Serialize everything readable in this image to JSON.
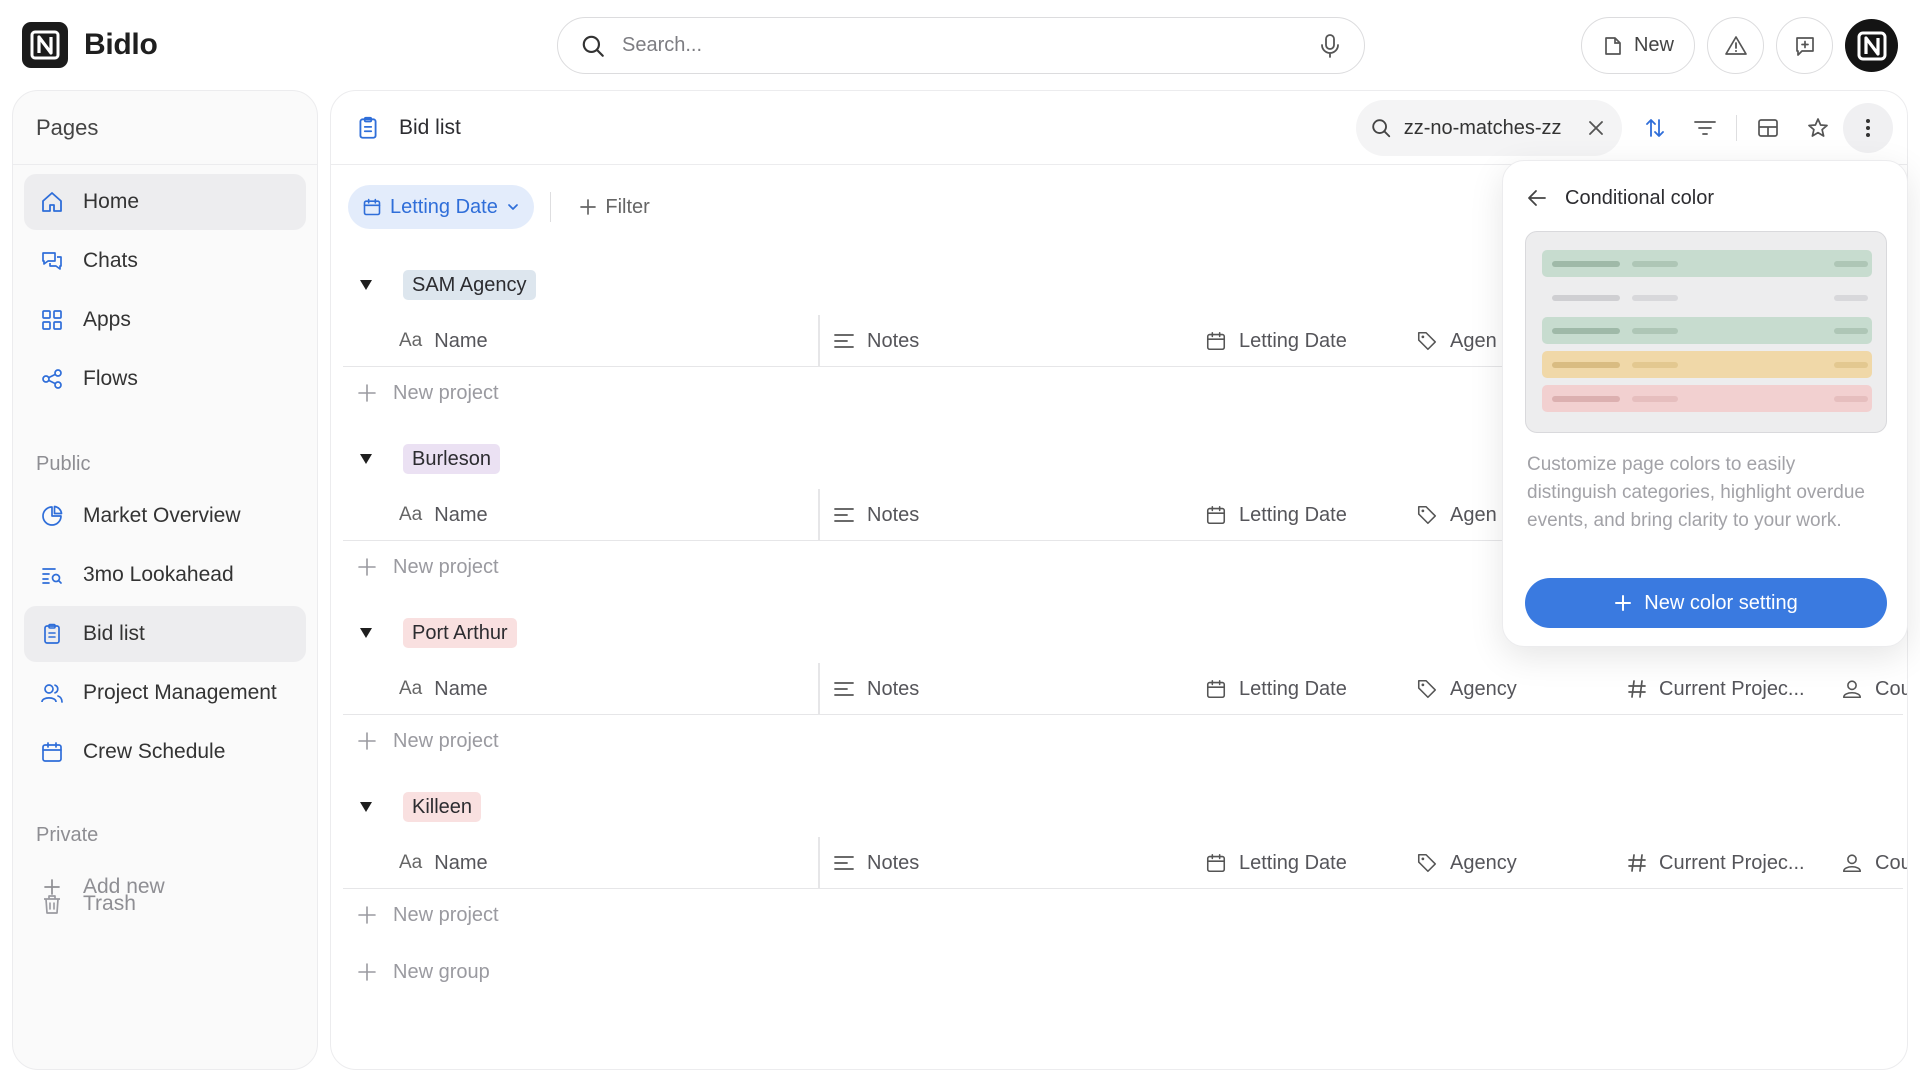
{
  "app": {
    "name": "Bidlo"
  },
  "search": {
    "placeholder": "Search..."
  },
  "top_actions": {
    "new_label": "New"
  },
  "sidebar": {
    "header": "Pages",
    "main_items": [
      {
        "label": "Home",
        "icon": "home-icon",
        "active": false
      },
      {
        "label": "Chats",
        "icon": "chats-icon",
        "active": false
      },
      {
        "label": "Apps",
        "icon": "apps-icon",
        "active": false
      },
      {
        "label": "Flows",
        "icon": "flows-icon",
        "active": false
      }
    ],
    "public_label": "Public",
    "public_items": [
      {
        "label": "Market Overview",
        "icon": "pie-chart-icon"
      },
      {
        "label": "3mo Lookahead",
        "icon": "list-search-icon"
      },
      {
        "label": "Bid list",
        "icon": "clipboard-icon",
        "active": true
      },
      {
        "label": "Project Management",
        "icon": "users-icon"
      },
      {
        "label": "Crew Schedule",
        "icon": "calendar-icon"
      }
    ],
    "private_label": "Private",
    "add_new_label": "Add new",
    "trash_label": "Trash"
  },
  "main": {
    "title": "Bid list",
    "search_query": "zz-no-matches-zz",
    "group_by_label": "Letting Date",
    "filter_label": "Filter",
    "columns": {
      "name": "Name",
      "name_prefix": "Aa",
      "notes": "Notes",
      "letting_date": "Letting Date",
      "agency": "Agency",
      "agency_clipped": "Agen",
      "current_projects": "Current Projec...",
      "cou": "Cou"
    },
    "groups": [
      {
        "label": "SAM Agency",
        "color": "#dde6ee"
      },
      {
        "label": "Burleson",
        "color": "#ebe1f3"
      },
      {
        "label": "Port Arthur",
        "color": "#f9e0e0"
      },
      {
        "label": "Killeen",
        "color": "#f9e0e0"
      }
    ],
    "new_project_label": "New project",
    "new_group_label": "New group"
  },
  "popover": {
    "title": "Conditional color",
    "description": "Customize page colors to easily distinguish categories, highlight overdue events, and bring clarity to your work.",
    "button_label": "New color setting",
    "preview_colors": [
      "#c7dccf",
      "#ededee",
      "#c7dccf",
      "#f0d8a8",
      "#f2d0d0"
    ]
  },
  "colors": {
    "accent": "#3a7ae0",
    "active_bg": "#ededef"
  }
}
